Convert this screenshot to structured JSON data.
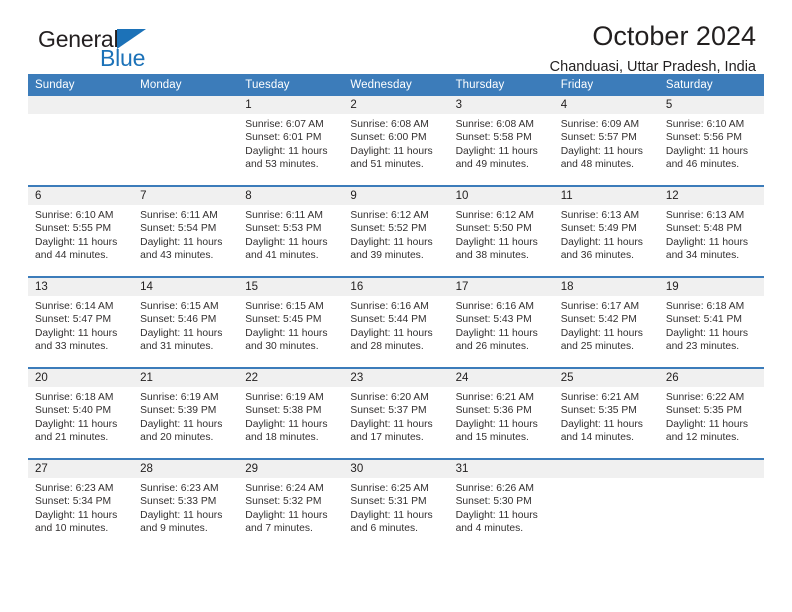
{
  "brand": {
    "name_top": "General",
    "name_bottom": "Blue",
    "triangle_color": "#1c72b8"
  },
  "header": {
    "title": "October 2024",
    "subtitle": "Chanduasi, Uttar Pradesh, India",
    "accent_color": "#3c7cba",
    "daynum_band_color": "#f0f0f0"
  },
  "weekdays": [
    "Sunday",
    "Monday",
    "Tuesday",
    "Wednesday",
    "Thursday",
    "Friday",
    "Saturday"
  ],
  "labels": {
    "sunrise_prefix": "Sunrise:",
    "sunset_prefix": "Sunset:",
    "daylight_prefix": "Daylight:"
  },
  "weeks": [
    [
      {
        "empty": true
      },
      {
        "empty": true
      },
      {
        "day": "1",
        "sunrise": "Sunrise: 6:07 AM",
        "sunset": "Sunset: 6:01 PM",
        "daylight": "Daylight: 11 hours and 53 minutes."
      },
      {
        "day": "2",
        "sunrise": "Sunrise: 6:08 AM",
        "sunset": "Sunset: 6:00 PM",
        "daylight": "Daylight: 11 hours and 51 minutes."
      },
      {
        "day": "3",
        "sunrise": "Sunrise: 6:08 AM",
        "sunset": "Sunset: 5:58 PM",
        "daylight": "Daylight: 11 hours and 49 minutes."
      },
      {
        "day": "4",
        "sunrise": "Sunrise: 6:09 AM",
        "sunset": "Sunset: 5:57 PM",
        "daylight": "Daylight: 11 hours and 48 minutes."
      },
      {
        "day": "5",
        "sunrise": "Sunrise: 6:10 AM",
        "sunset": "Sunset: 5:56 PM",
        "daylight": "Daylight: 11 hours and 46 minutes."
      }
    ],
    [
      {
        "day": "6",
        "sunrise": "Sunrise: 6:10 AM",
        "sunset": "Sunset: 5:55 PM",
        "daylight": "Daylight: 11 hours and 44 minutes."
      },
      {
        "day": "7",
        "sunrise": "Sunrise: 6:11 AM",
        "sunset": "Sunset: 5:54 PM",
        "daylight": "Daylight: 11 hours and 43 minutes."
      },
      {
        "day": "8",
        "sunrise": "Sunrise: 6:11 AM",
        "sunset": "Sunset: 5:53 PM",
        "daylight": "Daylight: 11 hours and 41 minutes."
      },
      {
        "day": "9",
        "sunrise": "Sunrise: 6:12 AM",
        "sunset": "Sunset: 5:52 PM",
        "daylight": "Daylight: 11 hours and 39 minutes."
      },
      {
        "day": "10",
        "sunrise": "Sunrise: 6:12 AM",
        "sunset": "Sunset: 5:50 PM",
        "daylight": "Daylight: 11 hours and 38 minutes."
      },
      {
        "day": "11",
        "sunrise": "Sunrise: 6:13 AM",
        "sunset": "Sunset: 5:49 PM",
        "daylight": "Daylight: 11 hours and 36 minutes."
      },
      {
        "day": "12",
        "sunrise": "Sunrise: 6:13 AM",
        "sunset": "Sunset: 5:48 PM",
        "daylight": "Daylight: 11 hours and 34 minutes."
      }
    ],
    [
      {
        "day": "13",
        "sunrise": "Sunrise: 6:14 AM",
        "sunset": "Sunset: 5:47 PM",
        "daylight": "Daylight: 11 hours and 33 minutes."
      },
      {
        "day": "14",
        "sunrise": "Sunrise: 6:15 AM",
        "sunset": "Sunset: 5:46 PM",
        "daylight": "Daylight: 11 hours and 31 minutes."
      },
      {
        "day": "15",
        "sunrise": "Sunrise: 6:15 AM",
        "sunset": "Sunset: 5:45 PM",
        "daylight": "Daylight: 11 hours and 30 minutes."
      },
      {
        "day": "16",
        "sunrise": "Sunrise: 6:16 AM",
        "sunset": "Sunset: 5:44 PM",
        "daylight": "Daylight: 11 hours and 28 minutes."
      },
      {
        "day": "17",
        "sunrise": "Sunrise: 6:16 AM",
        "sunset": "Sunset: 5:43 PM",
        "daylight": "Daylight: 11 hours and 26 minutes."
      },
      {
        "day": "18",
        "sunrise": "Sunrise: 6:17 AM",
        "sunset": "Sunset: 5:42 PM",
        "daylight": "Daylight: 11 hours and 25 minutes."
      },
      {
        "day": "19",
        "sunrise": "Sunrise: 6:18 AM",
        "sunset": "Sunset: 5:41 PM",
        "daylight": "Daylight: 11 hours and 23 minutes."
      }
    ],
    [
      {
        "day": "20",
        "sunrise": "Sunrise: 6:18 AM",
        "sunset": "Sunset: 5:40 PM",
        "daylight": "Daylight: 11 hours and 21 minutes."
      },
      {
        "day": "21",
        "sunrise": "Sunrise: 6:19 AM",
        "sunset": "Sunset: 5:39 PM",
        "daylight": "Daylight: 11 hours and 20 minutes."
      },
      {
        "day": "22",
        "sunrise": "Sunrise: 6:19 AM",
        "sunset": "Sunset: 5:38 PM",
        "daylight": "Daylight: 11 hours and 18 minutes."
      },
      {
        "day": "23",
        "sunrise": "Sunrise: 6:20 AM",
        "sunset": "Sunset: 5:37 PM",
        "daylight": "Daylight: 11 hours and 17 minutes."
      },
      {
        "day": "24",
        "sunrise": "Sunrise: 6:21 AM",
        "sunset": "Sunset: 5:36 PM",
        "daylight": "Daylight: 11 hours and 15 minutes."
      },
      {
        "day": "25",
        "sunrise": "Sunrise: 6:21 AM",
        "sunset": "Sunset: 5:35 PM",
        "daylight": "Daylight: 11 hours and 14 minutes."
      },
      {
        "day": "26",
        "sunrise": "Sunrise: 6:22 AM",
        "sunset": "Sunset: 5:35 PM",
        "daylight": "Daylight: 11 hours and 12 minutes."
      }
    ],
    [
      {
        "day": "27",
        "sunrise": "Sunrise: 6:23 AM",
        "sunset": "Sunset: 5:34 PM",
        "daylight": "Daylight: 11 hours and 10 minutes."
      },
      {
        "day": "28",
        "sunrise": "Sunrise: 6:23 AM",
        "sunset": "Sunset: 5:33 PM",
        "daylight": "Daylight: 11 hours and 9 minutes."
      },
      {
        "day": "29",
        "sunrise": "Sunrise: 6:24 AM",
        "sunset": "Sunset: 5:32 PM",
        "daylight": "Daylight: 11 hours and 7 minutes."
      },
      {
        "day": "30",
        "sunrise": "Sunrise: 6:25 AM",
        "sunset": "Sunset: 5:31 PM",
        "daylight": "Daylight: 11 hours and 6 minutes."
      },
      {
        "day": "31",
        "sunrise": "Sunrise: 6:26 AM",
        "sunset": "Sunset: 5:30 PM",
        "daylight": "Daylight: 11 hours and 4 minutes."
      },
      {
        "empty": true
      },
      {
        "empty": true
      }
    ]
  ]
}
